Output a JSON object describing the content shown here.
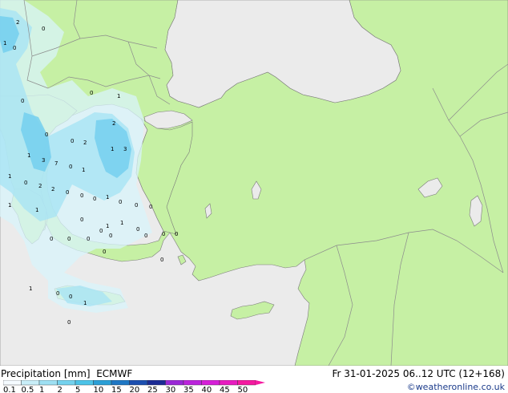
{
  "footer": {
    "product_label": "Precipitation [mm]",
    "model_label": "ECMWF",
    "valid_time": "Fr 31-01-2025 06..12 UTC (12+168)",
    "credit": "©weatheronline.co.uk"
  },
  "legend": {
    "ticks": [
      "0.1",
      "0.5",
      "1",
      "2",
      "5",
      "10",
      "15",
      "20",
      "25",
      "30",
      "35",
      "40",
      "45",
      "50"
    ],
    "colors": [
      "#f5fbff",
      "#c8eef8",
      "#9ee0f3",
      "#74d2ee",
      "#4cc3e8",
      "#2b9fd6",
      "#1f77c4",
      "#1c4fb0",
      "#1b2a94",
      "#9a28d6",
      "#bb24dc",
      "#d61fd8",
      "#e81cc0",
      "#f51aa0"
    ]
  },
  "map": {
    "colors": {
      "land": "#c6f0a4",
      "sea": "#ebebeb",
      "border": "#8c8c8c",
      "coast": "#7a7a7a",
      "precip_light": "#d8f4fb",
      "precip_medium": "#a8e4f4",
      "precip_heavy": "#74cfee"
    },
    "point_labels": [
      "2",
      "0",
      "1",
      "0",
      "1",
      "0",
      "0",
      "2",
      "3",
      "1",
      "2",
      "0",
      "0",
      "3",
      "7",
      "0",
      "1",
      "1",
      "2",
      "2",
      "1",
      "0",
      "1",
      "1",
      "0",
      "0",
      "0",
      "1",
      "0",
      "0",
      "0",
      "0",
      "0",
      "0",
      "0",
      "1",
      "0",
      "0",
      "1",
      "0",
      "0",
      "0",
      "0",
      "0",
      "0",
      "1",
      "0",
      "0",
      "1",
      "0"
    ]
  }
}
